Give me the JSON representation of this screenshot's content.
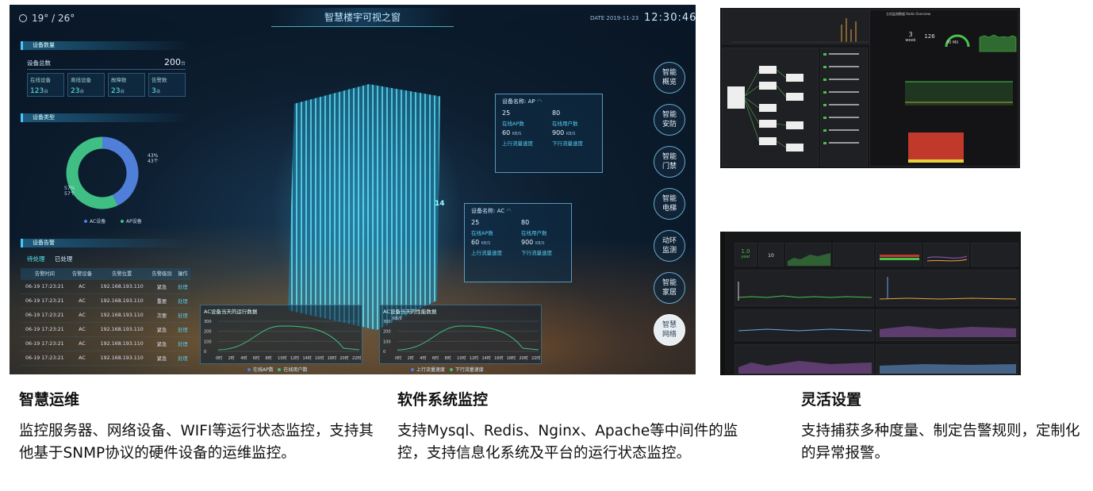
{
  "dashboard": {
    "weather": "19° / 26°",
    "title": "智慧楼宇可视之窗",
    "date": "DATE 2019-11-23",
    "time": "12:30:46",
    "device_count": {
      "header": "设备数量",
      "total_label": "设备总数",
      "total_value": "200",
      "total_unit": "台",
      "stats": [
        {
          "label": "在线设备",
          "value": "123",
          "unit": "台"
        },
        {
          "label": "离线设备",
          "value": "23",
          "unit": "台"
        },
        {
          "label": "故障数",
          "value": "23",
          "unit": "台"
        },
        {
          "label": "告警数",
          "value": "3",
          "unit": "台"
        }
      ]
    },
    "device_type": {
      "header": "设备类型",
      "right_pct": "43%",
      "right_cnt": "43个",
      "left_pct": "57%",
      "left_cnt": "57个",
      "legend": [
        "AC设备",
        "AP设备"
      ],
      "share_ac": 0.43,
      "colors": [
        "#4f7fd9",
        "#3fbf84"
      ]
    },
    "alarms": {
      "header": "设备告警",
      "tabs": [
        "待处理",
        "已处理"
      ],
      "columns": [
        "告警时间",
        "告警设备",
        "告警位置",
        "告警级别",
        "操作"
      ],
      "rows": [
        [
          "06-19  17:23:21",
          "AC",
          "192.168.193.110",
          "紧急",
          "处理"
        ],
        [
          "06-19  17:23:21",
          "AC",
          "192.168.193.110",
          "重要",
          "处理"
        ],
        [
          "06-19  17:23:21",
          "AC",
          "192.168.193.110",
          "次要",
          "处理"
        ],
        [
          "06-19  17:23:21",
          "AC",
          "192.168.193.110",
          "紧急",
          "处理"
        ],
        [
          "06-19  17:23:21",
          "AC",
          "192.168.193.110",
          "紧急",
          "处理"
        ],
        [
          "06-19  17:23:21",
          "AC",
          "192.168.193.110",
          "紧急",
          "处理"
        ]
      ]
    },
    "popup_ap": {
      "name": "设备名称: AP",
      "v1": "25",
      "v2": "80",
      "l1": "在线AP数",
      "l2": "在线用户数",
      "v3": "60",
      "u3": "KB/S",
      "v4": "900",
      "u4": "KB/S",
      "l3": "上行流量速度",
      "l4": "下行流量速度"
    },
    "popup_ac": {
      "name": "设备名称: AC",
      "v1": "25",
      "v2": "80",
      "l1": "在线AP数",
      "l2": "在线用户数",
      "v3": "60",
      "u3": "KB/S",
      "v4": "900",
      "u4": "KB/S",
      "l3": "上行流量速度",
      "l4": "下行流量速度"
    },
    "floor_label": "14",
    "nav": [
      "智能\n概览",
      "智能\n安防",
      "智能\n门禁",
      "智能\n电梯",
      "动环\n监测",
      "智能\n家居",
      "智慧\n网络"
    ],
    "chart_left": {
      "title": "AC设备当天的运行数据",
      "yticks": [
        "300",
        "200",
        "100",
        "0"
      ],
      "xticks": [
        "0时",
        "2时",
        "4时",
        "6时",
        "8时",
        "10时",
        "12时",
        "14时",
        "16时",
        "18时",
        "20时",
        "22时"
      ],
      "legend": [
        "在线AP数",
        "在线用户数"
      ]
    },
    "chart_right": {
      "title": "AC设备当天的性能数据",
      "unit": "KB/S",
      "yticks": [
        "300",
        "200",
        "100",
        "0"
      ],
      "xticks": [
        "0时",
        "2时",
        "4时",
        "6时",
        "8时",
        "10时",
        "12时",
        "14时",
        "16时",
        "18时",
        "20时",
        "22时"
      ],
      "legend": [
        "上行流量速度",
        "下行流量速度"
      ]
    }
  },
  "grafana1": {
    "title": "主机监测数据 Redis Overview",
    "uptime_value": "3",
    "uptime_unit": "week",
    "clients_value": "126",
    "memory_value": "30 Mil"
  },
  "grafana2": {
    "uptime_value": "1.0",
    "uptime_unit": "year",
    "second_value": "10"
  },
  "captions": [
    {
      "title": "智慧运维",
      "body": "监控服务器、网络设备、WIFI等运行状态监控，支持其他基于SNMP协议的硬件设备的运维监控。"
    },
    {
      "title": "软件系统监控",
      "body": "支持Mysql、Redis、Nginx、Apache等中间件的监控，支持信息化系统及平台的运行状态监控。"
    },
    {
      "title": "灵活设置",
      "body": "支持捕获多种度量、制定告警规则，定制化的异常报警。"
    }
  ]
}
